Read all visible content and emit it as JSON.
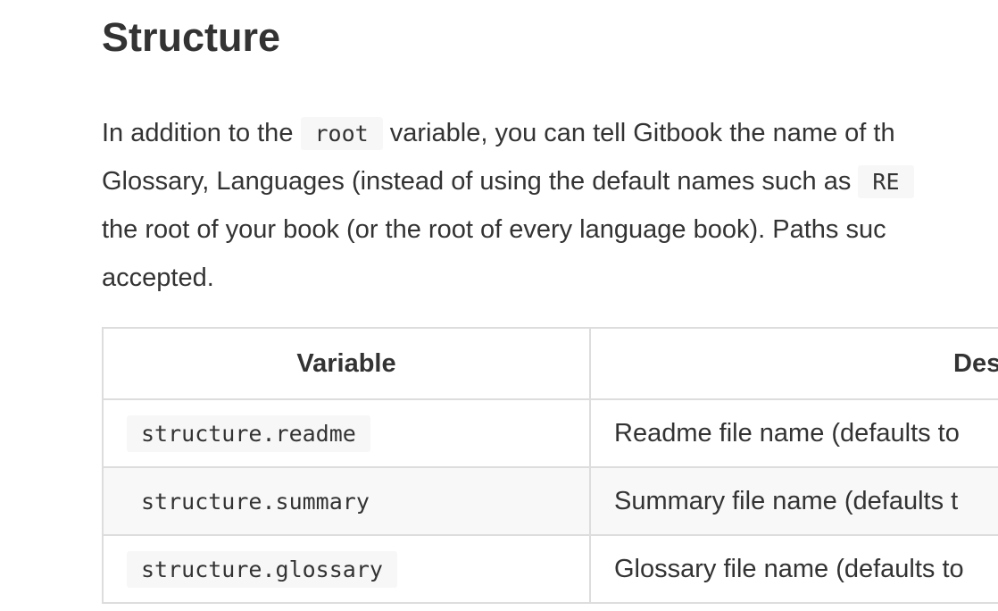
{
  "section": {
    "title": "Structure"
  },
  "paragraph": {
    "line1_pre": "In addition to the ",
    "line1_code": "root",
    "line1_post": " variable, you can tell Gitbook the name of th",
    "line2_pre": "Glossary, Languages (instead of using the default names such as ",
    "line2_code": "RE",
    "line3": "the root of your book (or the root of every language book). Paths suc",
    "line4": "accepted."
  },
  "table": {
    "headers": [
      "Variable",
      "Des"
    ],
    "rows": [
      {
        "variable": "structure.readme",
        "description": "Readme file name (defaults to"
      },
      {
        "variable": "structure.summary",
        "description": "Summary file name (defaults t"
      },
      {
        "variable": "structure.glossary",
        "description": "Glossary file name (defaults to"
      }
    ]
  },
  "colors": {
    "text": "#333333",
    "code_bg": "#f7f7f7",
    "border": "#dddddd",
    "alt_row_bg": "#f8f8f8"
  }
}
